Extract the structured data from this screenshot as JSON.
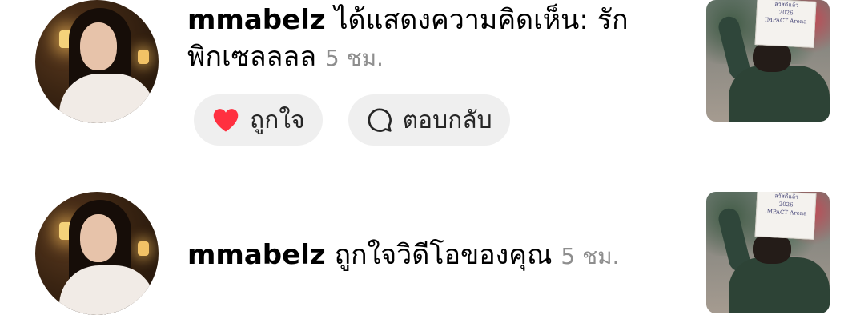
{
  "notifications": [
    {
      "username": "mmabelz",
      "message": " ได้แสดงความคิดเห็น: รักพิกเซลลลล",
      "time": "5 ชม.",
      "like_label": "ถูกใจ",
      "reply_label": "ตอบกลับ",
      "like_icon": "heart-icon",
      "reply_icon": "speech-bubble-icon"
    },
    {
      "username": "mmabelz",
      "message": " ถูกใจวิดีโอของคุณ",
      "time": "5 ชม."
    }
  ],
  "thumbnail_sign_text": [
    "สวัสดีแล้ว",
    "2026",
    "IMPACT Arena"
  ],
  "colors": {
    "like_heart": "#ff3040",
    "pill_bg": "#efefef",
    "secondary_text": "#8e8e8e"
  }
}
